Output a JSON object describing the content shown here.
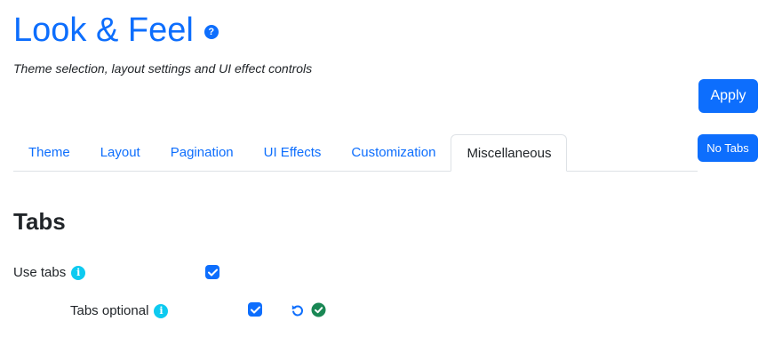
{
  "header": {
    "title": "Look & Feel",
    "subtitle": "Theme selection, layout settings and UI effect controls",
    "help_icon": "question-circle"
  },
  "actions": {
    "apply_label": "Apply",
    "no_tabs_label": "No Tabs"
  },
  "tabs": [
    {
      "label": "Theme",
      "active": false
    },
    {
      "label": "Layout",
      "active": false
    },
    {
      "label": "Pagination",
      "active": false
    },
    {
      "label": "UI Effects",
      "active": false
    },
    {
      "label": "Customization",
      "active": false
    },
    {
      "label": "Miscellaneous",
      "active": true
    }
  ],
  "section": {
    "title": "Tabs",
    "settings": [
      {
        "label": "Use tabs",
        "checked": true,
        "info_icon": "info-circle"
      },
      {
        "label": "Tabs optional",
        "checked": true,
        "info_icon": "info-circle",
        "actions": [
          "undo-icon",
          "check-circle-icon"
        ]
      }
    ]
  },
  "colors": {
    "primary": "#0d6efd",
    "info": "#0dcaf0",
    "success": "#198754",
    "text": "#212529",
    "border": "#dee2e6"
  }
}
